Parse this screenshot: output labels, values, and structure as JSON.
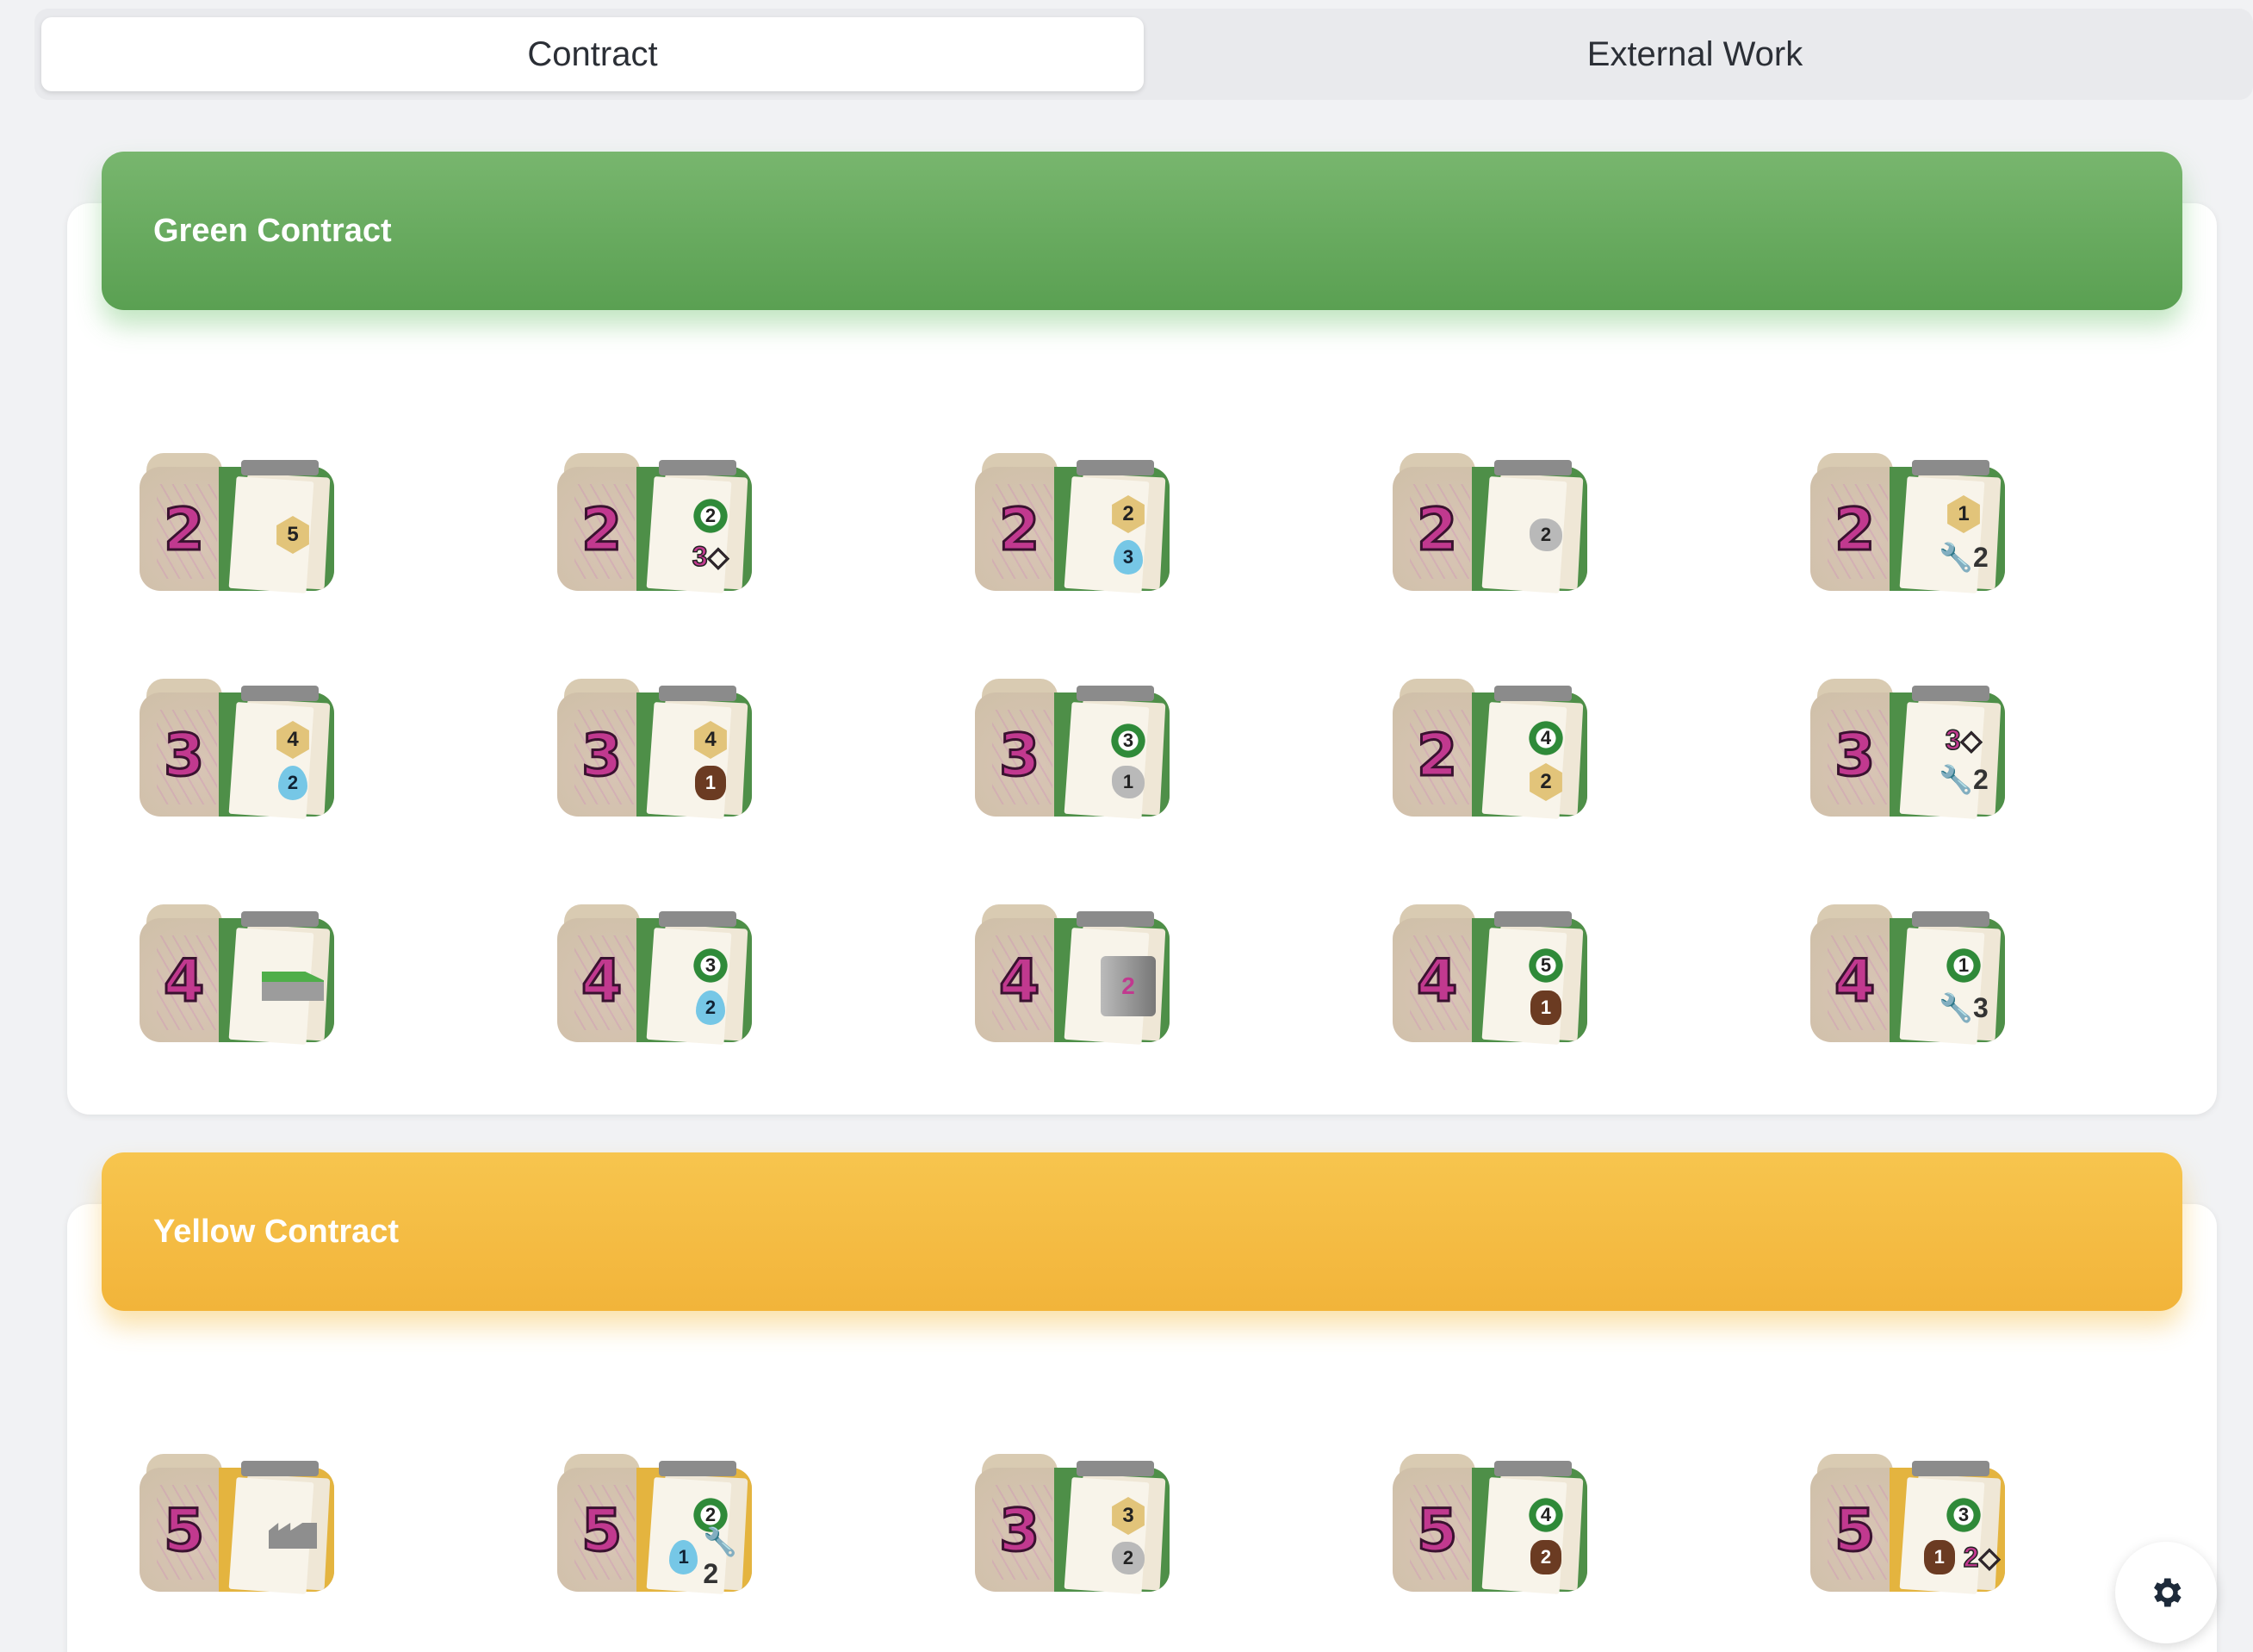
{
  "tabs": {
    "contract": "Contract",
    "external": "External Work"
  },
  "green": {
    "title": "Green Contract",
    "tiles": [
      {
        "num": "2",
        "icons": [
          {
            "t": "hex",
            "v": "5"
          }
        ]
      },
      {
        "num": "2",
        "icons": [
          {
            "t": "wreath",
            "v": "2"
          },
          {
            "t": "arrow",
            "v": "3"
          }
        ]
      },
      {
        "num": "2",
        "icons": [
          {
            "t": "hex",
            "v": "2"
          },
          {
            "t": "drop",
            "v": "3"
          }
        ]
      },
      {
        "num": "2",
        "icons": [
          {
            "t": "stone",
            "v": "2"
          }
        ]
      },
      {
        "num": "2",
        "icons": [
          {
            "t": "hex",
            "v": "1"
          },
          {
            "t": "wrench",
            "v": "2"
          }
        ]
      },
      {
        "num": "3",
        "icons": [
          {
            "t": "hex",
            "v": "4"
          },
          {
            "t": "drop",
            "v": "2"
          }
        ]
      },
      {
        "num": "3",
        "icons": [
          {
            "t": "hex",
            "v": "4"
          },
          {
            "t": "wood",
            "v": "1"
          }
        ]
      },
      {
        "num": "3",
        "icons": [
          {
            "t": "wreath",
            "v": "3"
          },
          {
            "t": "stone",
            "v": "1"
          }
        ]
      },
      {
        "num": "2",
        "icons": [
          {
            "t": "wreath",
            "v": "4"
          },
          {
            "t": "hex",
            "v": "2"
          }
        ]
      },
      {
        "num": "3",
        "icons": [
          {
            "t": "arrow",
            "v": "3"
          },
          {
            "t": "wrench",
            "v": "2"
          }
        ]
      },
      {
        "num": "4",
        "icons": [
          {
            "t": "wall",
            "v": ""
          }
        ]
      },
      {
        "num": "4",
        "icons": [
          {
            "t": "wreath",
            "v": "3"
          },
          {
            "t": "drop",
            "v": "2"
          }
        ]
      },
      {
        "num": "4",
        "icons": [
          {
            "t": "silo",
            "v": "2"
          }
        ]
      },
      {
        "num": "4",
        "icons": [
          {
            "t": "wreath",
            "v": "5"
          },
          {
            "t": "wood",
            "v": "1"
          }
        ]
      },
      {
        "num": "4",
        "icons": [
          {
            "t": "wreath",
            "v": "1"
          },
          {
            "t": "wrench",
            "v": "3"
          }
        ]
      }
    ]
  },
  "yellow": {
    "title": "Yellow Contract",
    "tiles": [
      {
        "num": "5",
        "folder": "y",
        "icons": [
          {
            "t": "factory",
            "v": ""
          }
        ]
      },
      {
        "num": "5",
        "folder": "y",
        "icons": [
          {
            "t": "wreath",
            "v": "2"
          },
          {
            "row": [
              {
                "t": "drop",
                "v": "1"
              },
              {
                "t": "wrench",
                "v": "2"
              }
            ]
          }
        ]
      },
      {
        "num": "3",
        "icons": [
          {
            "t": "hex",
            "v": "3"
          },
          {
            "t": "stone",
            "v": "2"
          }
        ]
      },
      {
        "num": "5",
        "icons": [
          {
            "t": "wreath",
            "v": "4"
          },
          {
            "t": "wood",
            "v": "2"
          }
        ]
      },
      {
        "num": "5",
        "folder": "y",
        "icons": [
          {
            "t": "wreath",
            "v": "3"
          },
          {
            "row": [
              {
                "t": "wood",
                "v": "1"
              },
              {
                "t": "arrow",
                "v": "2"
              }
            ]
          }
        ]
      }
    ]
  },
  "icons": {
    "settings": "gear-icon"
  }
}
